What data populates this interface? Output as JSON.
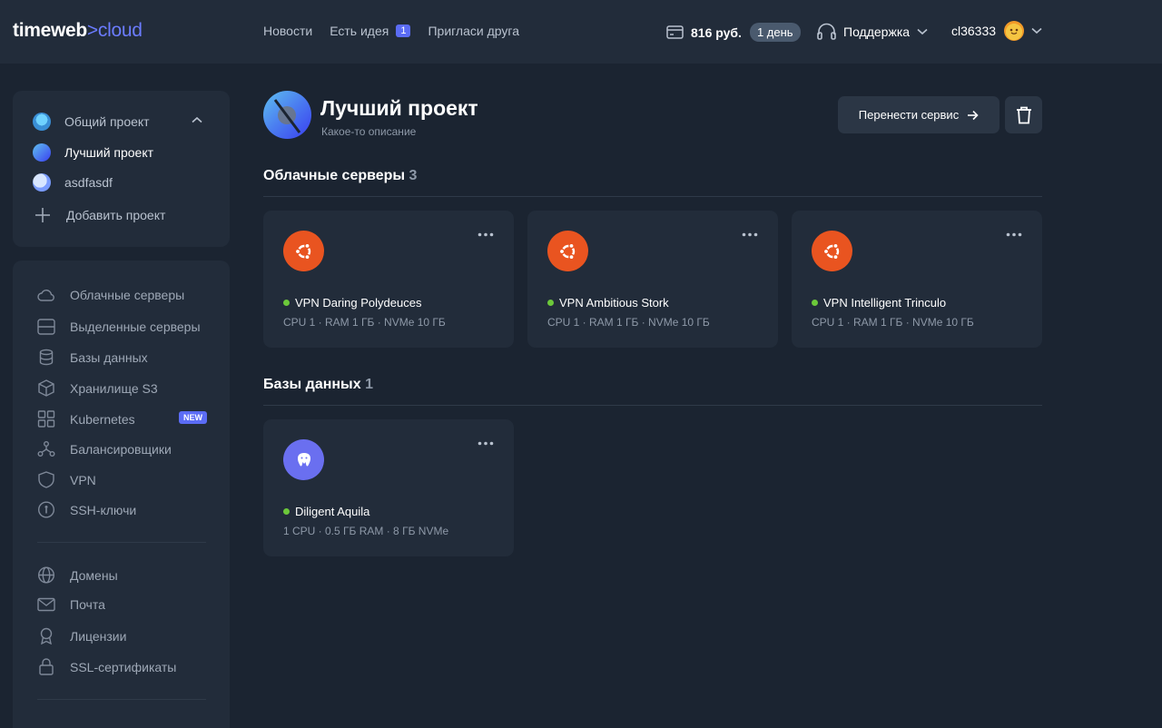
{
  "header": {
    "logo_main": "timeweb",
    "logo_accent": ">cloud",
    "nav": [
      {
        "label": "Новости"
      },
      {
        "label": "Есть идея",
        "badge": "1"
      },
      {
        "label": "Пригласи друга"
      }
    ],
    "balance": "816 руб.",
    "days": "1 день",
    "support": "Поддержка",
    "username": "cl36333"
  },
  "projects": {
    "items": [
      {
        "label": "Общий проект"
      },
      {
        "label": "Лучший проект"
      },
      {
        "label": "asdfasdf"
      }
    ],
    "add_label": "Добавить проект"
  },
  "services": {
    "group1": [
      {
        "label": "Облачные серверы",
        "icon": "cloud-icon"
      },
      {
        "label": "Выделенные серверы",
        "icon": "server-icon"
      },
      {
        "label": "Базы данных",
        "icon": "database-icon"
      },
      {
        "label": "Хранилище S3",
        "icon": "cube-icon"
      },
      {
        "label": "Kubernetes",
        "icon": "grid-icon",
        "badge": "NEW"
      },
      {
        "label": "Балансировщики",
        "icon": "network-icon"
      },
      {
        "label": "VPN",
        "icon": "shield-icon"
      },
      {
        "label": "SSH-ключи",
        "icon": "key-icon"
      }
    ],
    "group2": [
      {
        "label": "Домены",
        "icon": "globe-icon"
      },
      {
        "label": "Почта",
        "icon": "mail-icon"
      },
      {
        "label": "Лицензии",
        "icon": "award-icon"
      },
      {
        "label": "SSL-сертификаты",
        "icon": "lock-icon"
      }
    ]
  },
  "project": {
    "title": "Лучший проект",
    "description": "Какое-то описание",
    "transfer_label": "Перенести сервис"
  },
  "sections": {
    "servers": {
      "title": "Облачные серверы",
      "count": "3",
      "cards": [
        {
          "name": "VPN Daring Polydeuces",
          "spec": "CPU 1 · RAM 1 ГБ · NVMe 10 ГБ",
          "icon": "ubuntu-icon",
          "color": "#e95420"
        },
        {
          "name": "VPN Ambitious Stork",
          "spec": "CPU 1 · RAM 1 ГБ · NVMe 10 ГБ",
          "icon": "ubuntu-icon",
          "color": "#e95420"
        },
        {
          "name": "VPN Intelligent Trinculo",
          "spec": "CPU 1 · RAM 1 ГБ · NVMe 10 ГБ",
          "icon": "ubuntu-icon",
          "color": "#e95420"
        }
      ]
    },
    "databases": {
      "title": "Базы данных",
      "count": "1",
      "cards": [
        {
          "name": "Diligent Aquila",
          "spec": "1 CPU · 0.5 ГБ RAM · 8 ГБ NVMe",
          "icon": "postgresql-icon",
          "color": "#6a6ff0"
        }
      ]
    }
  },
  "colors": {
    "accent": "#5b6cf5",
    "status_online": "#6cc83a"
  }
}
